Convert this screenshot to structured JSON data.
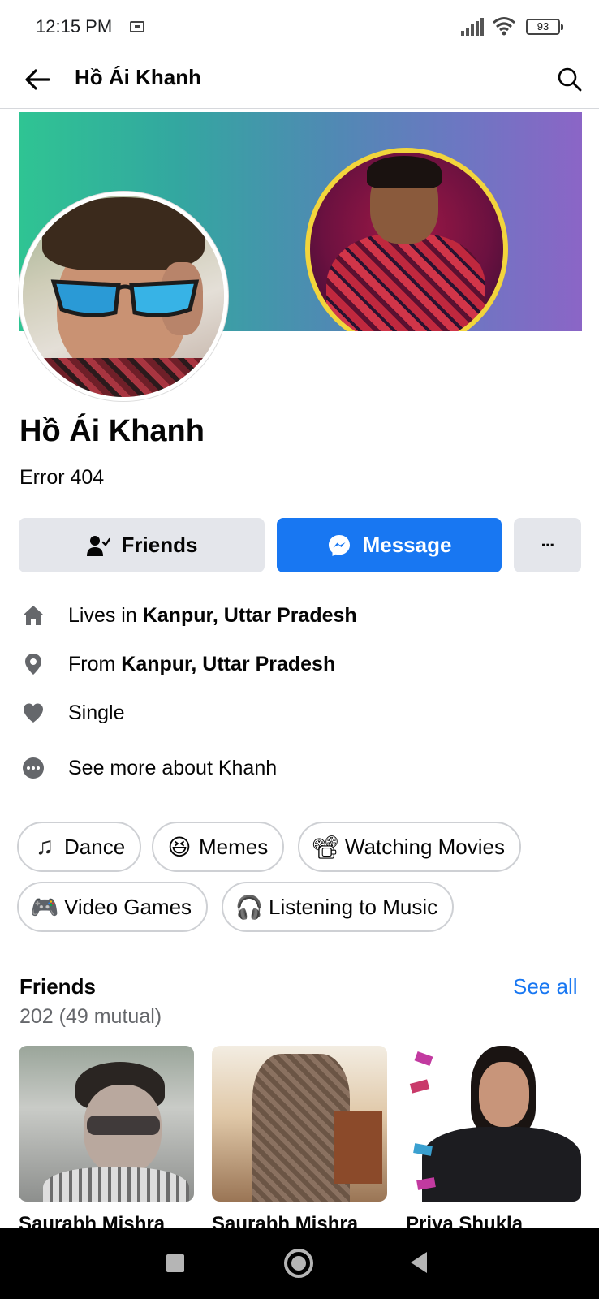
{
  "status_bar": {
    "time": "12:15 PM",
    "battery": "93"
  },
  "header": {
    "title": "Hồ Ái Khanh"
  },
  "profile": {
    "name": "Hồ Ái Khanh",
    "bio": "Error 404"
  },
  "actions": {
    "friends_label": "Friends",
    "message_label": "Message",
    "more_label": "···"
  },
  "details": {
    "lives": {
      "prefix": "Lives in ",
      "value": "Kanpur, Uttar Pradesh"
    },
    "from": {
      "prefix": "From ",
      "value": "Kanpur, Uttar Pradesh"
    },
    "relationship": "Single",
    "see_more": "See more about Khanh"
  },
  "hobbies": [
    {
      "label": "Dance",
      "emoji": "♫"
    },
    {
      "label": "Memes",
      "emoji": "😆"
    },
    {
      "label": "Watching Movies",
      "emoji": "📽"
    },
    {
      "label": "Video Games",
      "emoji": "🎮"
    },
    {
      "label": "Listening to Music",
      "emoji": "🎧"
    }
  ],
  "friends": {
    "title": "Friends",
    "see_all": "See all",
    "count": "202 (49 mutual)",
    "items": [
      {
        "name": "Saurabh Mishra"
      },
      {
        "name": "Saurabh Mishra"
      },
      {
        "name": "Priya Shukla"
      }
    ]
  },
  "colors": {
    "accent": "#1877f2",
    "button_gray": "#e4e6eb",
    "text_secondary": "#65676b"
  }
}
